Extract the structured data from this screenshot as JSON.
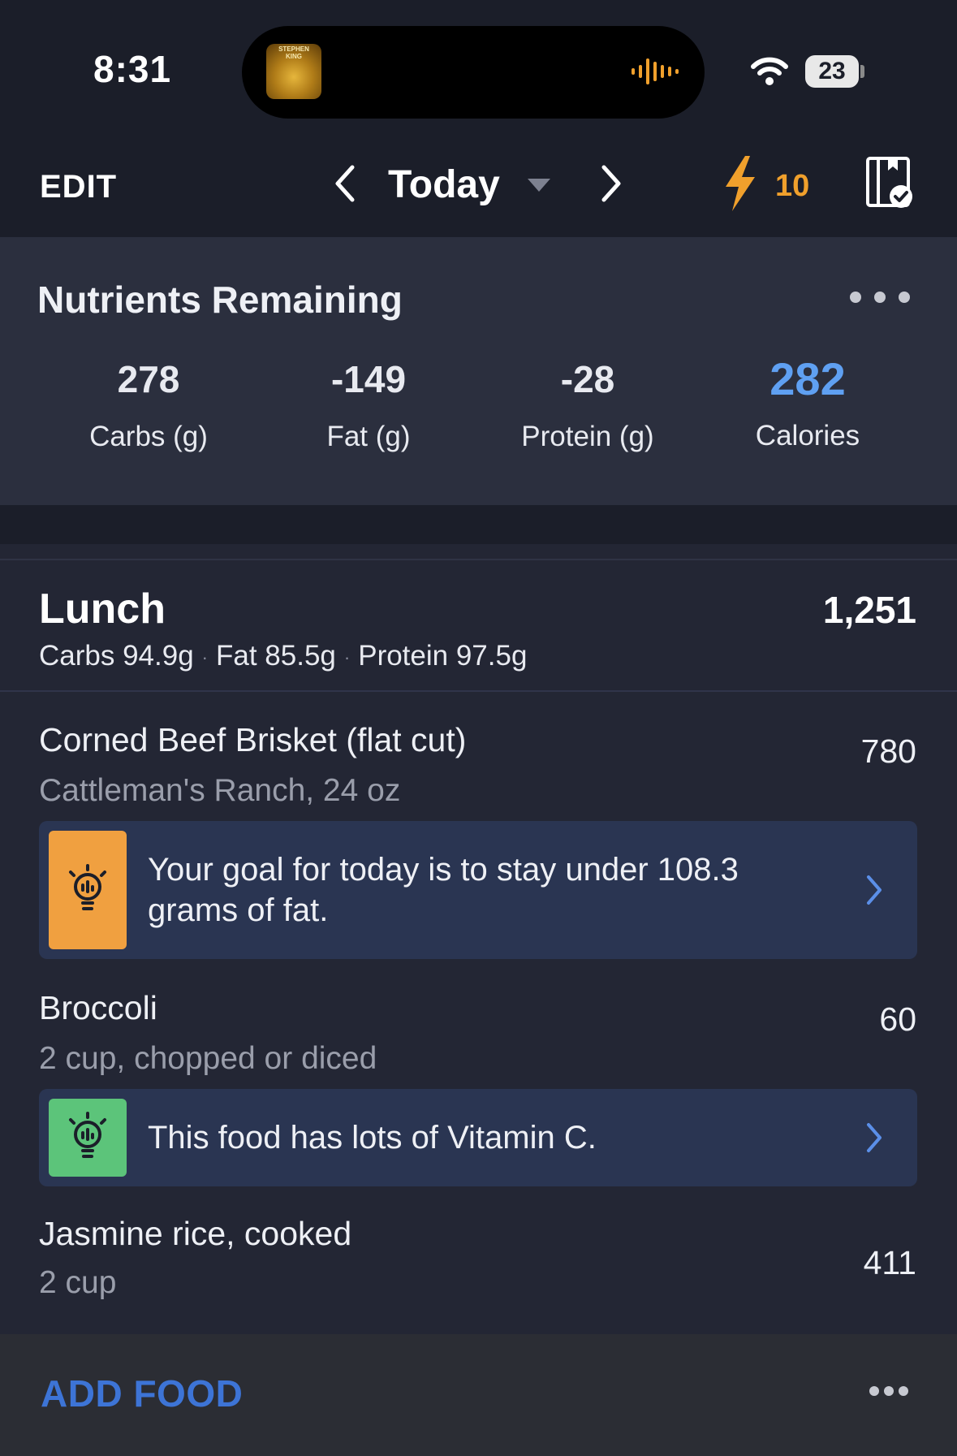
{
  "status_bar": {
    "time": "8:31",
    "album_art_text": "STEPHEN KING",
    "battery": "23"
  },
  "header": {
    "edit_label": "EDIT",
    "date_label": "Today",
    "streak_count": "10",
    "accent_color": "#f0a02c"
  },
  "nutrients": {
    "title": "Nutrients Remaining",
    "carbs": {
      "value": "278",
      "label": "Carbs (g)"
    },
    "fat": {
      "value": "-149",
      "label": "Fat (g)"
    },
    "protein": {
      "value": "-28",
      "label": "Protein (g)"
    },
    "calories": {
      "value": "282",
      "label": "Calories",
      "color": "#5fa0f2"
    }
  },
  "meal": {
    "title": "Lunch",
    "calories": "1,251",
    "macros": {
      "carbs": "Carbs 94.9g",
      "fat": "Fat 85.5g",
      "protein": "Protein 97.5g"
    },
    "items": [
      {
        "name": "Corned Beef Brisket (flat cut)",
        "detail": "Cattleman's Ranch, 24 oz",
        "calories": "780",
        "tip": {
          "line1": "Your goal for today is to stay under 108.3",
          "line2": "grams of fat.",
          "icon": "lightbulb-icon",
          "color": "#f0a040"
        }
      },
      {
        "name": "Broccoli",
        "detail": "2 cup, chopped or diced",
        "calories": "60",
        "tip": {
          "line1": "This food has lots of Vitamin C.",
          "icon": "lightbulb-icon",
          "color": "#5cc47a"
        }
      },
      {
        "name": "Jasmine rice, cooked",
        "detail": "2 cup",
        "calories": "411"
      }
    ]
  },
  "footer": {
    "add_food_label": "ADD FOOD"
  }
}
